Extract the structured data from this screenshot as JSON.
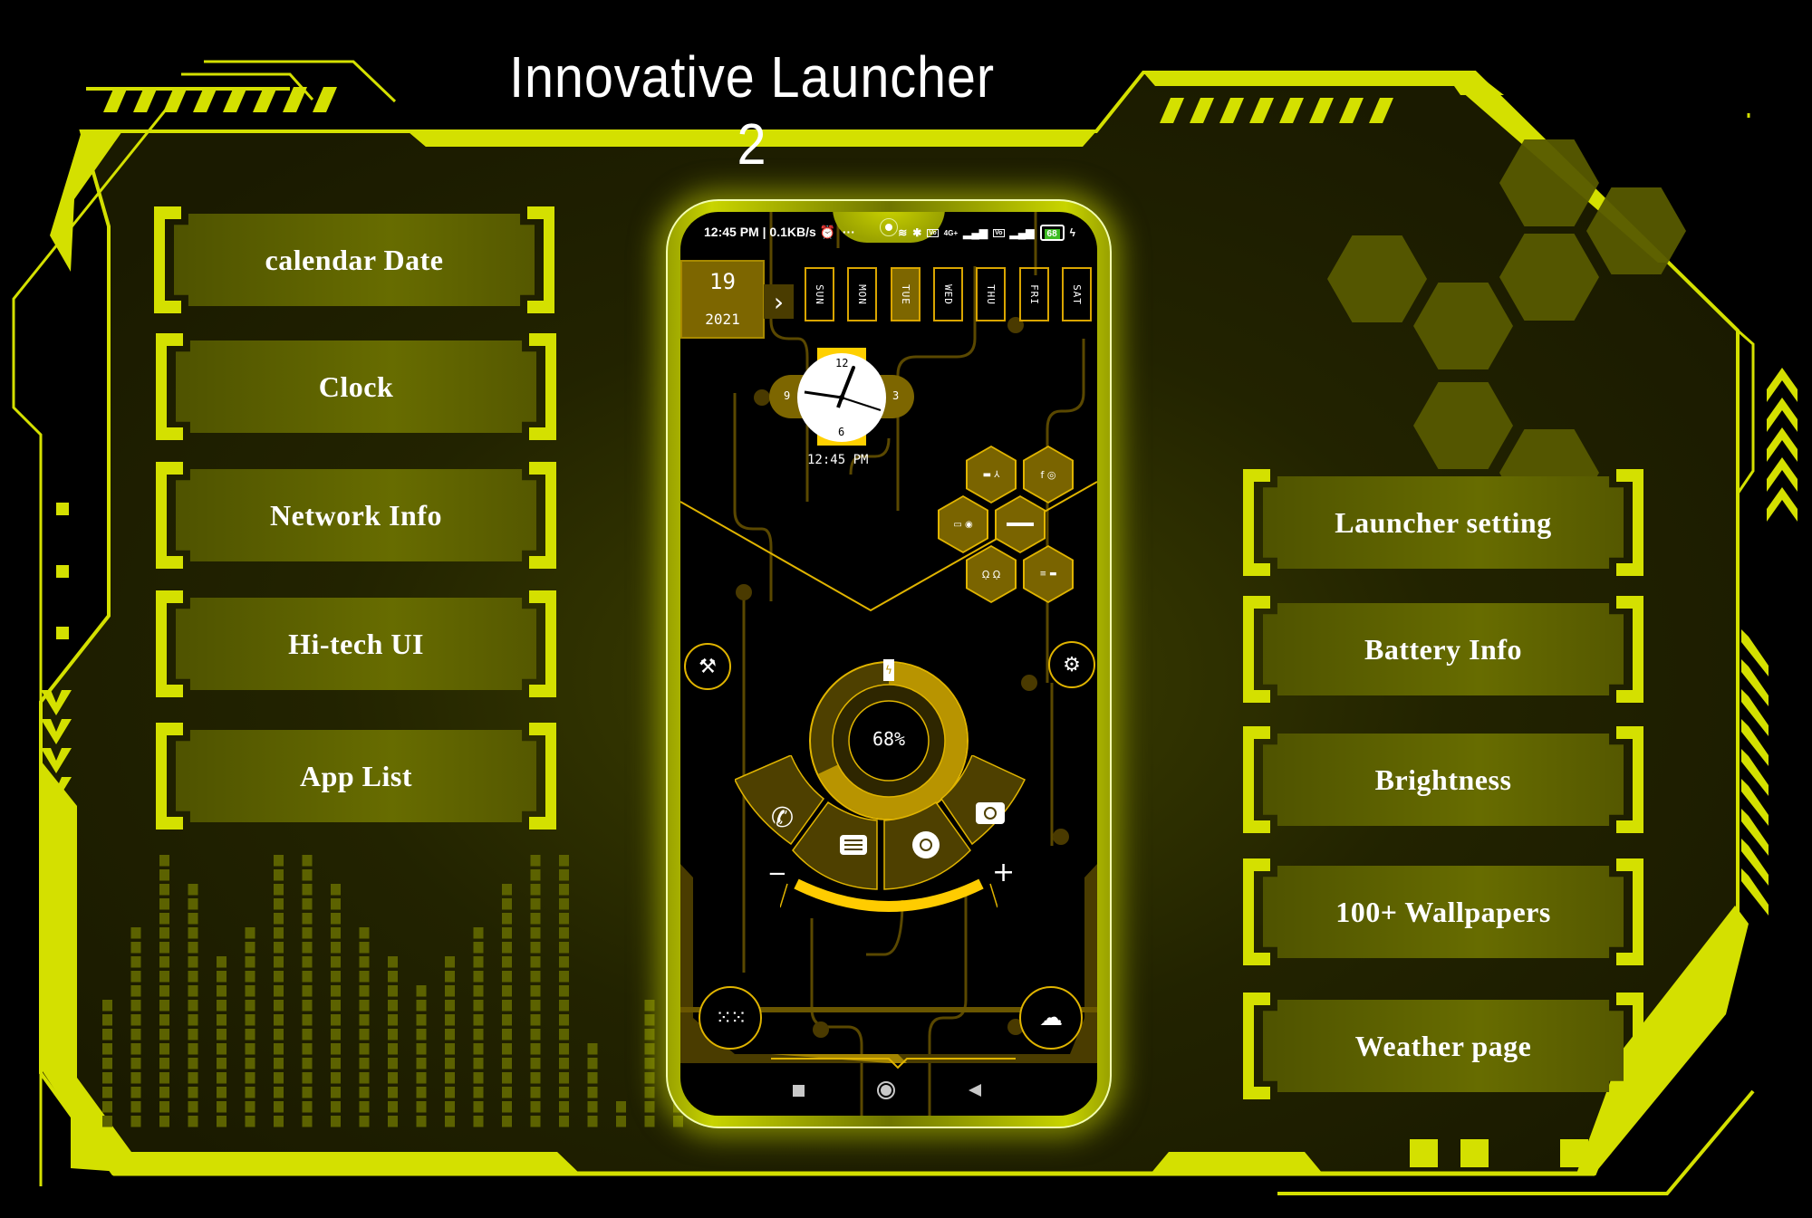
{
  "title": "Innovative Launcher 2",
  "colors": {
    "accent": "#d4e000",
    "panel": "#1c1c00",
    "button_face": "#5c6000",
    "phone_gold": "#7d6600",
    "gold_line": "#e0b400"
  },
  "left_menu": [
    {
      "label": "calendar Date"
    },
    {
      "label": "Clock"
    },
    {
      "label": "Network Info"
    },
    {
      "label": "Hi-tech UI"
    },
    {
      "label": "App List"
    }
  ],
  "right_menu": [
    {
      "label": "Launcher setting"
    },
    {
      "label": "Battery Info"
    },
    {
      "label": "Brightness"
    },
    {
      "label": "100+ Wallpapers"
    },
    {
      "label": "Weather page"
    }
  ],
  "phone": {
    "status_bar": {
      "time": "12:45 PM",
      "speed": "0.1KB/s",
      "network": "4G+",
      "battery": "68",
      "icons": [
        "alarm-icon",
        "more-icon",
        "wifi-icon",
        "bluetooth-icon",
        "volte-icon",
        "signal-icon",
        "volte-icon",
        "signal-icon",
        "battery-icon",
        "charging-icon"
      ]
    },
    "date": {
      "day": "19",
      "year": "2021"
    },
    "weekdays": [
      "SUN",
      "MON",
      "TUE",
      "WED",
      "THU",
      "FRI",
      "SAT"
    ],
    "active_weekday": "TUE",
    "clock": {
      "n12": "12",
      "n3": "3",
      "n6": "6",
      "n9": "9",
      "digital": "12:45 PM"
    },
    "battery": {
      "percent_label": "68%",
      "level": 0.68
    },
    "dock_apps": [
      {
        "name": "phone",
        "icon": "phone-icon"
      },
      {
        "name": "messages",
        "icon": "message-icon"
      },
      {
        "name": "chrome",
        "icon": "chrome-icon"
      },
      {
        "name": "camera",
        "icon": "camera-icon"
      }
    ],
    "brightness": {
      "minus": "−",
      "plus": "+"
    },
    "side_buttons": {
      "tools": "tools-icon",
      "settings": "gear-icon",
      "apps": "app-grid-icon",
      "weather": "weather-icon"
    },
    "nav": [
      "recents-icon",
      "home-icon",
      "back-icon"
    ]
  }
}
